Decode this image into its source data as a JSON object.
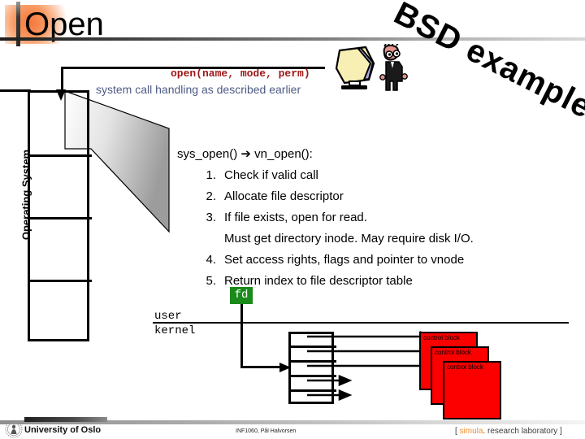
{
  "slide": {
    "title": "Open",
    "watermark": "BSD example",
    "vertical_label": "Operating System",
    "call_signature": "open(name, mode, perm)",
    "syscall_note": "system call handling as described earlier",
    "body_heading": "sys_open() ➔ vn_open():",
    "steps": [
      {
        "num": "1.",
        "text": "Check if valid call"
      },
      {
        "num": "2.",
        "text": "Allocate file descriptor"
      },
      {
        "num": "3.",
        "text": "If file exists, open for read."
      },
      {
        "num": "4.",
        "text": "Set access rights, flags and pointer to vnode"
      },
      {
        "num": "5.",
        "text": "Return index to file descriptor table"
      }
    ],
    "step3_continuation": "Must get directory inode. May require disk I/O.",
    "fd_badge": "fd",
    "user_label": "user",
    "kernel_label": "kernel",
    "control_blocks": [
      "control block",
      "control block",
      "control block"
    ]
  },
  "footer": {
    "university": "University of Oslo",
    "course": "INF1060, Pål Halvorsen",
    "lab_open_bracket": "[ ",
    "lab_brand": "simula",
    "lab_rest": ". research laboratory",
    "lab_close_bracket": " ]"
  },
  "colors": {
    "accent_orange": "#f4763a",
    "call_red": "#9e1616",
    "note_blue": "#4d5a84",
    "fd_green": "#1a8a1a",
    "control_block_red": "#fc0000",
    "simula_orange": "#ef8f2a"
  }
}
